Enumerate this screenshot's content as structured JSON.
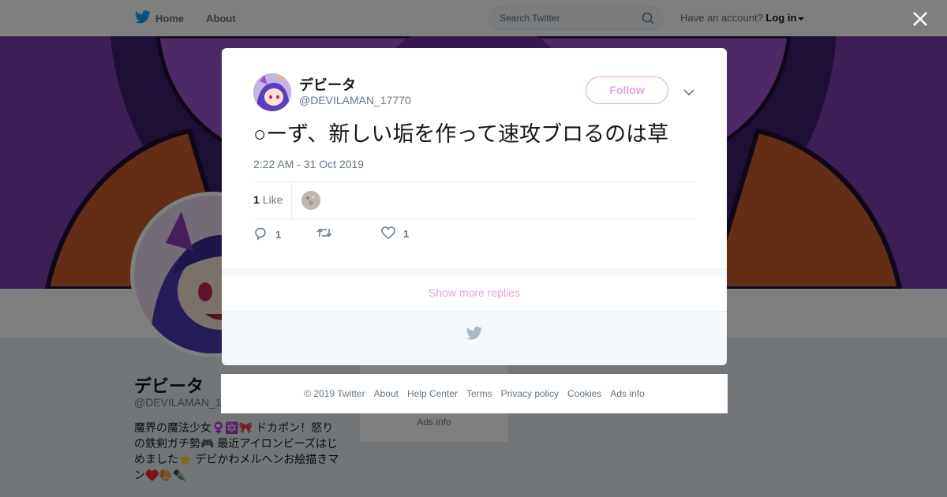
{
  "topbar": {
    "nav": [
      {
        "label": "Home",
        "icon": "twitter-bird-icon"
      },
      {
        "label": "About"
      }
    ],
    "search_placeholder": "Search Twitter",
    "account_prompt": "Have an account?",
    "login_label": "Log in"
  },
  "profile": {
    "name": "デビータ",
    "handle": "@DEVILAMAN_1",
    "bio": "魔界の魔法少女♀️🔯🎀 ドカポン！怒りの鉄剣ガチ勢🎮 最近アイロンビーズはじめました⭐ デビかわメルヘンお絵描きマン♥️🎨✒️",
    "side_ads_label": "Ads info"
  },
  "tweet": {
    "author_name": "デビータ",
    "author_handle": "@DEVILAMAN_17770",
    "follow_label": "Follow",
    "text": "○ーず、新しい垢を作って速攻ブロるのは草",
    "timestamp": "2:22 AM - 31 Oct 2019",
    "likes_count": "1",
    "likes_label": "Like",
    "reply_count": "1",
    "retweet_count": "",
    "like_count": "1"
  },
  "modal": {
    "show_more_label": "Show more replies"
  },
  "footer": {
    "links": [
      "© 2019 Twitter",
      "About",
      "Help Center",
      "Terms",
      "Privacy policy",
      "Cookies",
      "Ads info"
    ]
  },
  "colors": {
    "accent": "#e2a4de",
    "twitter_blue": "#1da1f2",
    "text_primary": "#14171a",
    "text_secondary": "#657786"
  }
}
